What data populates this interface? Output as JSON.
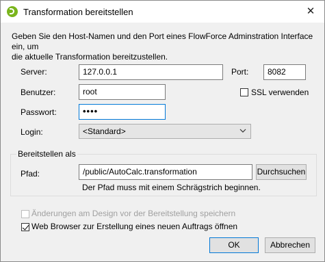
{
  "dialog": {
    "title": "Transformation bereitstellen",
    "intro_line1": "Geben Sie den Host-Namen und den Port eines FlowForce Adminstration Interface ein, um",
    "intro_line2": "die aktuelle Transformation bereitzustellen."
  },
  "fields": {
    "server_label": "Server:",
    "server_value": "127.0.0.1",
    "port_label": "Port:",
    "port_value": "8082",
    "user_label": "Benutzer:",
    "user_value": "root",
    "ssl_label": "SSL verwenden",
    "ssl_checked": false,
    "password_label": "Passwort:",
    "password_value": "••••",
    "login_label": "Login:",
    "login_value": "<Standard>"
  },
  "deploy": {
    "group_label": "Bereitstellen als",
    "path_label": "Pfad:",
    "path_value": "/public/AutoCalc.transformation",
    "browse_label": "Durchsuchen",
    "hint": "Der Pfad muss mit einem Schrägstrich beginnen."
  },
  "options": {
    "save_changes_label": "Änderungen am Design vor der Bereitstellung speichern",
    "save_changes_checked": false,
    "save_changes_enabled": false,
    "open_browser_label": "Web Browser zur Erstellung eines neuen Auftrags öffnen",
    "open_browser_checked": true
  },
  "buttons": {
    "ok_label": "OK",
    "cancel_label": "Abbrechen"
  },
  "icons": {
    "app": "altova-app-icon",
    "close": "close-icon",
    "dropdown": "chevron-down-icon"
  },
  "colors": {
    "focus_border": "#0078d7",
    "app_icon": "#7ab51d",
    "dialog_bg": "#f0f0f0"
  }
}
